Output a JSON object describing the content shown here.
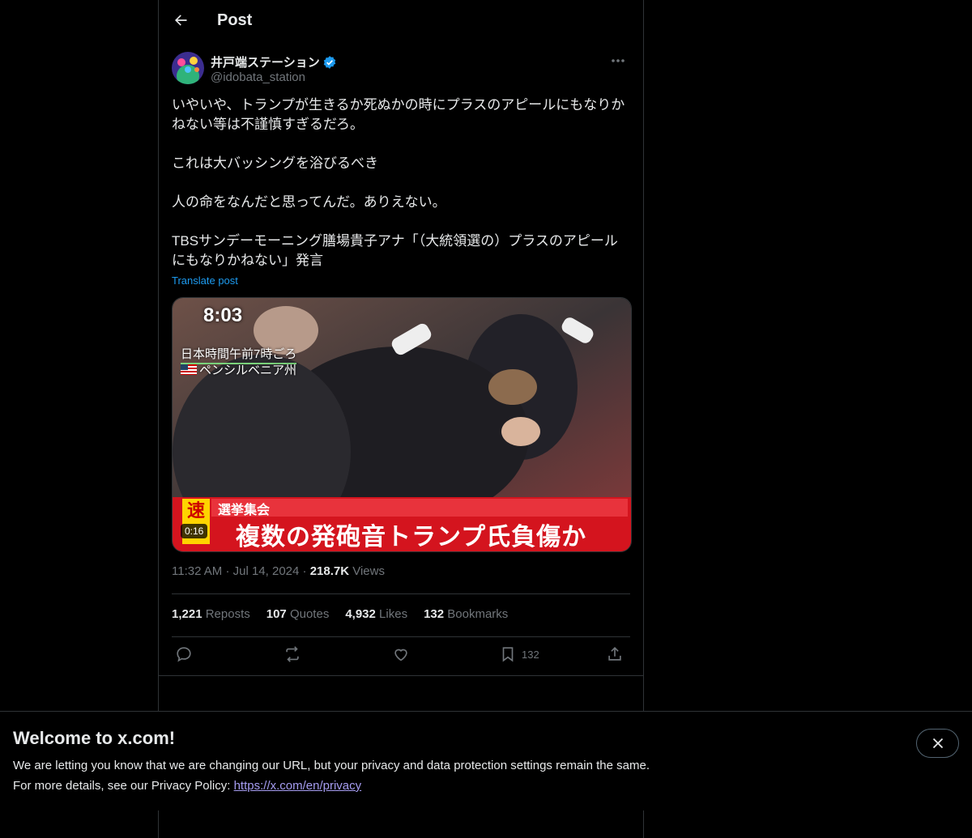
{
  "header": {
    "title": "Post"
  },
  "author": {
    "display_name": "井戸端ステーション",
    "handle": "@idobata_station",
    "verified": true
  },
  "post": {
    "text": "いやいや、トランプが生きるか死ぬかの時にプラスのアピールにもなりかねない等は不謹慎すぎるだろ。\n\nこれは大バッシングを浴びるべき\n\n人の命をなんだと思ってんだ。ありえない。\n\nTBSサンデーモーニング膳場貴子アナ「（大統領選の）プラスのアピールにもなりかねない」発言",
    "translate_label": "Translate post",
    "media": {
      "duration": "0:16",
      "clock": "8:03",
      "location_line1": "日本時間午前7時ごろ",
      "location_line2": "ペンシルベニア州",
      "breaking_label": "速",
      "banner_tag": "選挙集会",
      "banner_headline": "複数の発砲音トランプ氏負傷か"
    },
    "time": "11:32 AM",
    "date": "Jul 14, 2024",
    "views_count": "218.7K",
    "views_label": "Views",
    "sep": "·"
  },
  "stats": {
    "reposts_count": "1,221",
    "reposts_label": "Reposts",
    "quotes_count": "107",
    "quotes_label": "Quotes",
    "likes_count": "4,932",
    "likes_label": "Likes",
    "bookmarks_count": "132",
    "bookmarks_label": "Bookmarks"
  },
  "actions": {
    "bookmark_count": "132"
  },
  "cookie_banner": {
    "title": "Welcome to x.com!",
    "line1": "We are letting you know that we are changing our URL, but your privacy and data protection settings remain the same.",
    "line2_prefix": "For more details, see our Privacy Policy: ",
    "link_text": "https://x.com/en/privacy"
  },
  "colors": {
    "accent": "#1d9bf0",
    "muted": "#71767b",
    "text": "#e7e9ea",
    "border": "#2f3336"
  }
}
